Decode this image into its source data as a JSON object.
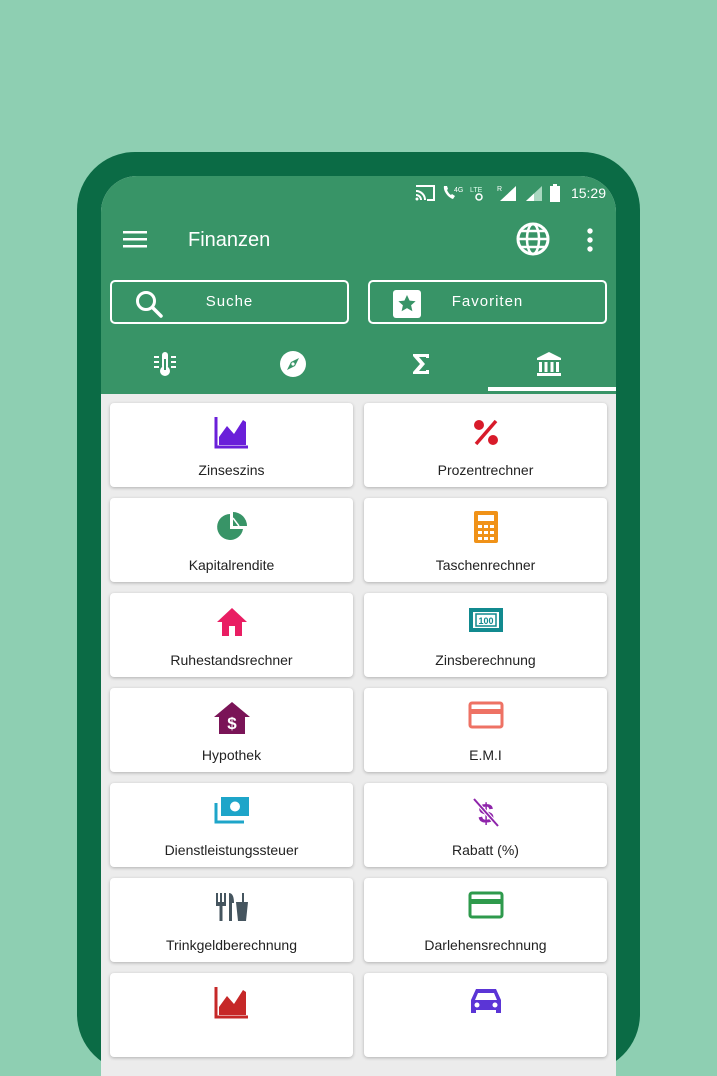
{
  "status_bar": {
    "time": "15:29",
    "network": "4G",
    "lte": "LTE",
    "roaming": "R"
  },
  "toolbar": {
    "title": "Finanzen",
    "menu_icon": "hamburger-menu-icon",
    "language_icon": "globe-icon",
    "overflow_icon": "more-vert-icon"
  },
  "actions": {
    "search_label": "Suche",
    "favorites_label": "Favoriten"
  },
  "tabs": [
    {
      "icon": "thermometer-icon"
    },
    {
      "icon": "compass-icon"
    },
    {
      "icon": "sigma-icon"
    },
    {
      "icon": "bank-icon",
      "selected": true
    }
  ],
  "items": [
    {
      "label": "Zinseszins",
      "icon": "chart-line-icon",
      "color": "#6a1fd9"
    },
    {
      "label": "Prozentrechner",
      "icon": "percent-icon",
      "color": "#d81b2a"
    },
    {
      "label": "Kapitalrendite",
      "icon": "pie-chart-icon",
      "color": "#389467"
    },
    {
      "label": "Taschenrechner",
      "icon": "calculator-icon",
      "color": "#f09218"
    },
    {
      "label": "Ruhestandsrechner",
      "icon": "home-icon",
      "color": "#e91e63"
    },
    {
      "label": "Zinsberechnung",
      "icon": "banknote-100-icon",
      "color": "#118a8f"
    },
    {
      "label": "Hypothek",
      "icon": "home-dollar-icon",
      "color": "#7a1457"
    },
    {
      "label": "E.M.I",
      "icon": "credit-card-icon",
      "color": "#ee7264"
    },
    {
      "label": "Dienstleistungssteuer",
      "icon": "money-stack-icon",
      "color": "#1ea5c9"
    },
    {
      "label": "Rabatt (%)",
      "icon": "dollar-off-icon",
      "color": "#8e24aa"
    },
    {
      "label": "Trinkgeldberechnung",
      "icon": "restaurant-icon",
      "color": "#45555f"
    },
    {
      "label": "Darlehensrechnung",
      "icon": "card-icon",
      "color": "#2e9a4c"
    },
    {
      "label": "",
      "icon": "chart-line-icon",
      "color": "#c62828"
    },
    {
      "label": "",
      "icon": "car-icon",
      "color": "#5b35d6"
    }
  ]
}
